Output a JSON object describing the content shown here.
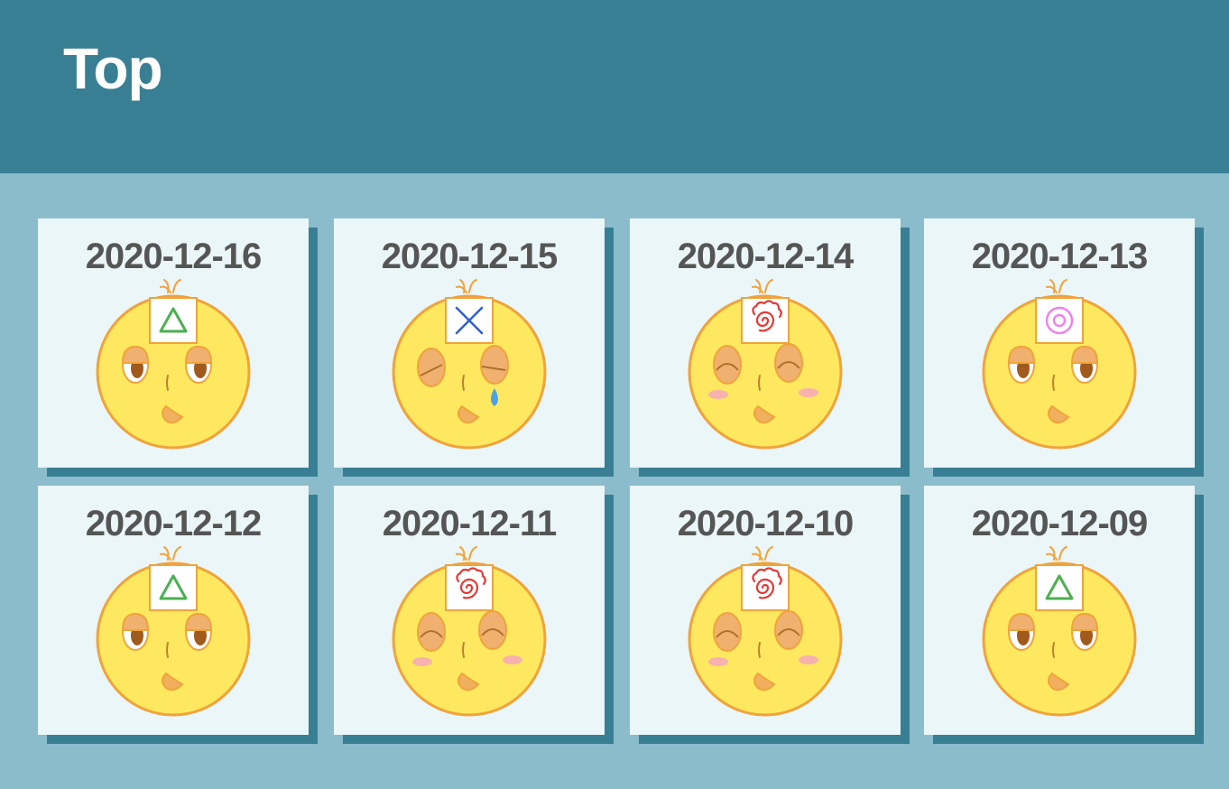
{
  "header": {
    "title": "Top"
  },
  "diary_entries": [
    {
      "date": "2020-12-16",
      "mood": "triangle",
      "face": "neutral"
    },
    {
      "date": "2020-12-15",
      "mood": "cross",
      "face": "crying"
    },
    {
      "date": "2020-12-14",
      "mood": "spiral",
      "face": "blushing"
    },
    {
      "date": "2020-12-13",
      "mood": "double-circle",
      "face": "neutral"
    },
    {
      "date": "2020-12-12",
      "mood": "triangle",
      "face": "neutral"
    },
    {
      "date": "2020-12-11",
      "mood": "spiral",
      "face": "blushing"
    },
    {
      "date": "2020-12-10",
      "mood": "spiral",
      "face": "blushing"
    },
    {
      "date": "2020-12-09",
      "mood": "triangle",
      "face": "neutral"
    }
  ],
  "colors": {
    "header_bg": "#387f94",
    "page_bg": "#8bbccb",
    "card_bg": "#eaf6f8",
    "card_shadow": "#387f94",
    "date_text": "#555555",
    "face_fill": "#fde860",
    "face_stroke": "#f0a33b",
    "triangle": "#4caf50",
    "cross": "#2f5fd0",
    "spiral": "#e53935",
    "double_circle": "#ee82ee"
  }
}
